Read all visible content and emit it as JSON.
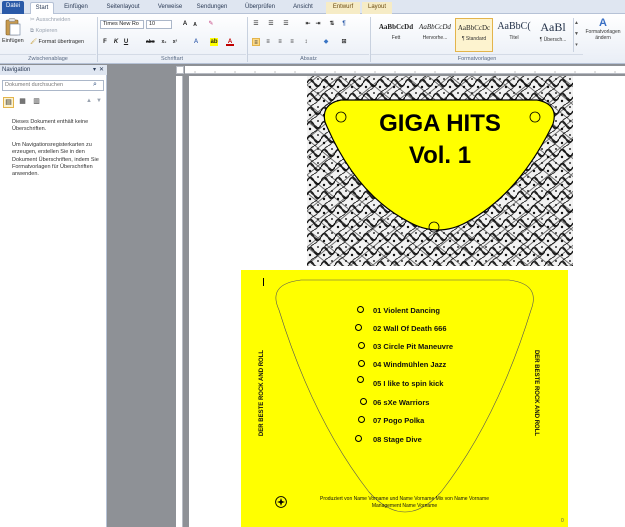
{
  "ribbon": {
    "tabs": [
      "Datei",
      "Start",
      "Einfügen",
      "Seitenlayout",
      "Verweise",
      "Sendungen",
      "Überprüfen",
      "Ansicht",
      "Entwurf",
      "Layout"
    ],
    "clipboard": {
      "paste": "Einfügen",
      "cut": "Ausschneiden",
      "copy": "Kopieren",
      "format_painter": "Format übertragen",
      "group": "Zwischenablage"
    },
    "font": {
      "name": "Times New Ro",
      "size": "10",
      "group": "Schriftart"
    },
    "paragraph": {
      "group": "Absatz"
    },
    "styles": {
      "items": [
        {
          "preview": "AaBbCcDd",
          "name": "Fett"
        },
        {
          "preview": "AaBbCcDd",
          "name": "Hervorhe..."
        },
        {
          "preview": "AaBbCcDc",
          "name": "¶ Standard"
        },
        {
          "preview": "AaBbC(",
          "name": "Titel"
        },
        {
          "preview": "AaBl",
          "name": "¶ Übersch..."
        }
      ],
      "change": "Formatvorlagen ändern",
      "group": "Formatvorlagen"
    }
  },
  "nav": {
    "title": "Navigation",
    "search_placeholder": "Dokument durchsuchen",
    "message1": "Dieses Dokument enthält keine Überschriften.",
    "message2": "Um Navigationsregisterkarten zu erzeugen, erstellen Sie in den Dokument Überschriften, indem Sie Formatvorlagen für Überschriften anwenden."
  },
  "cover": {
    "title": "GIGA HITS",
    "subtitle": "Vol. 1"
  },
  "back": {
    "tracks": [
      "01 Violent Dancing",
      "02 Wall Of Death 666",
      "03 Circle Pit Maneuvre",
      "04 Windmühlen Jazz",
      "05 I like to spin kick",
      "06 sXe Warriors",
      "07 Pogo Polka",
      "08 Stage Dive"
    ],
    "side_left": "DER BESTE ROCK AND ROLL",
    "side_right": "DER BESTE ROCK AND ROLL",
    "credits_line1": "Produziert von Name Vorname und Name Vorname Mix von Name Vorname",
    "credits_line2": "Management Name Vorname",
    "page_number": "0"
  }
}
